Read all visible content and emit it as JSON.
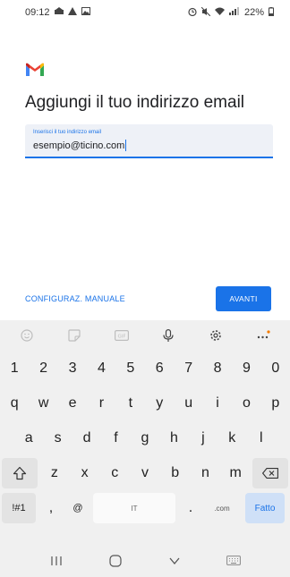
{
  "status_bar": {
    "time": "09:12",
    "battery": "22%",
    "left_icons": [
      "notification-icon",
      "alert-icon",
      "image-icon"
    ],
    "right_icons": [
      "alarm-icon",
      "mute-icon",
      "wifi-icon",
      "signal-icon",
      "battery-icon"
    ]
  },
  "brand": {
    "logo": "gmail-logo",
    "colors": {
      "red": "#ea4335",
      "blue": "#4285f4",
      "green": "#34a853",
      "yellow": "#fbbc04"
    }
  },
  "title": "Aggiungi il tuo indirizzo email",
  "email_field": {
    "label": "Inserisci il tuo indirizzo email",
    "value": "esempio@ticino.com"
  },
  "actions": {
    "manual_label": "CONFIGURAZ. MANUALE",
    "next_label": "AVANTI"
  },
  "keyboard": {
    "toolbar": [
      "emoji-icon",
      "sticker-icon",
      "gif-icon",
      "microphone-icon",
      "settings-icon",
      "more-icon"
    ],
    "rows": [
      [
        "1",
        "2",
        "3",
        "4",
        "5",
        "6",
        "7",
        "8",
        "9",
        "0"
      ],
      [
        "q",
        "w",
        "e",
        "r",
        "t",
        "y",
        "u",
        "i",
        "o",
        "p"
      ],
      [
        "a",
        "s",
        "d",
        "f",
        "g",
        "h",
        "j",
        "k",
        "l"
      ],
      [
        "z",
        "x",
        "c",
        "v",
        "b",
        "n",
        "m"
      ]
    ],
    "symbols_label": "!#1",
    "comma": ",",
    "at": "@",
    "space_label": "IT",
    "period": ".",
    "dotcom": ".com",
    "done_label": "Fatto",
    "shift_icon": "shift-icon",
    "backspace_icon": "backspace-icon"
  },
  "nav": [
    "recents-icon",
    "home-icon",
    "back-icon",
    "keyboard-icon"
  ],
  "accent_color": "#1a73e8"
}
